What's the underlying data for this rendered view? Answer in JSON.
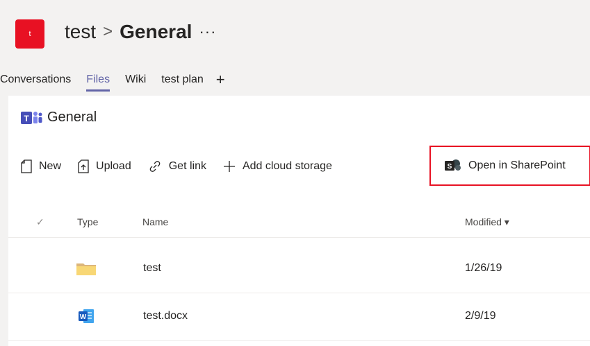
{
  "header": {
    "team_avatar_letter": "t",
    "team_name": "test",
    "separator": ">",
    "channel_name": "General",
    "more": "···",
    "accent": "#6264a7"
  },
  "tabs": [
    {
      "label": "Conversations",
      "active": false
    },
    {
      "label": "Files",
      "active": true
    },
    {
      "label": "Wiki",
      "active": false
    },
    {
      "label": "test plan",
      "active": false
    }
  ],
  "library": {
    "title": "General",
    "icon": "teams-icon"
  },
  "toolbar": {
    "new_label": "New",
    "upload_label": "Upload",
    "get_link_label": "Get link",
    "add_cloud_label": "Add cloud storage",
    "open_sharepoint_label": "Open in SharePoint",
    "highlight_color": "#e81123"
  },
  "table": {
    "columns": {
      "check": "✓",
      "type": "Type",
      "name": "Name",
      "modified": "Modified ▾"
    },
    "rows": [
      {
        "icon": "folder-icon",
        "name": "test",
        "modified": "1/26/19"
      },
      {
        "icon": "word-doc-icon",
        "name": "test.docx",
        "modified": "2/9/19"
      }
    ]
  }
}
